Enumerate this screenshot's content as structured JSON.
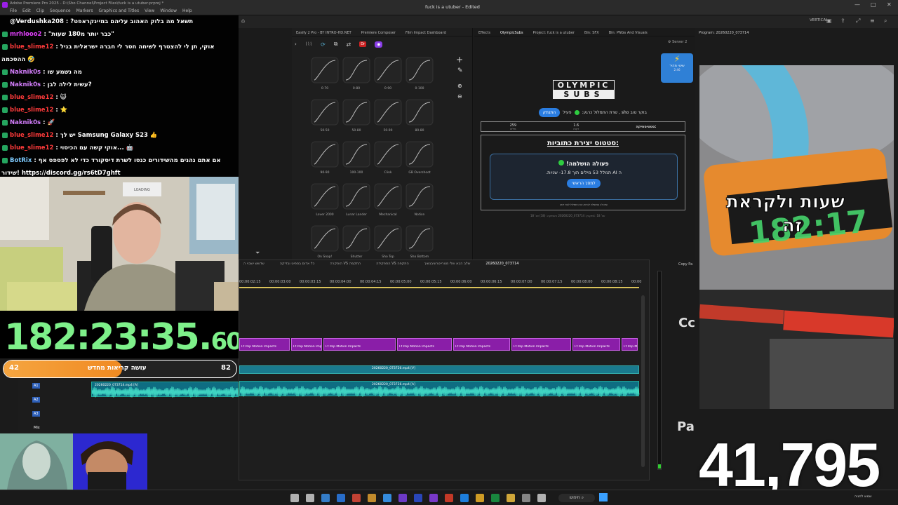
{
  "titlebar": {
    "path": "Adobe Premiere Pro 2025 - D:\\Sho Channel\\Project Files\\fuck is a utuber.prproj *",
    "menu": [
      "File",
      "Edit",
      "Clip",
      "Sequence",
      "Markers",
      "Graphics and Titles",
      "View",
      "Window",
      "Help"
    ],
    "center_title": "fuck is a utuber - Edited"
  },
  "topbar": {
    "label": "VERTICAL"
  },
  "chat": {
    "header": "@Verdushka208 : ?תשאל מה בלוק האהוב עליהם במיינקראפט",
    "lines": [
      {
        "user": "mrhlooo2",
        "text": "\"כבר יותר מ180 שעות\"",
        "color": "#e040fb"
      },
      {
        "user": "blue_slime12",
        "text": "אוקי, תן לי להצטרף לשיחה חסר לי חברה ישראלית בגיל",
        "color": "#ff3b3b"
      },
      {
        "user": "",
        "text": "ההסכמה 🤣",
        "color": "#fff"
      },
      {
        "user": "Naknik0s",
        "text": "מה נשמע שו",
        "color": "#d67fff"
      },
      {
        "user": "Naknik0s",
        "text": "עשית לילה לבן?",
        "color": "#d67fff"
      },
      {
        "user": "blue_slime12",
        "text": "😺",
        "color": "#ff3b3b"
      },
      {
        "user": "blue_slime12",
        "text": "⭐",
        "color": "#ff3b3b"
      },
      {
        "user": "Naknik0s",
        "text": "🚀",
        "color": "#d67fff"
      },
      {
        "user": "blue_slime12",
        "text": "יש לך Samsung Galaxy S23 👍",
        "color": "#ff3b3b"
      },
      {
        "user": "blue_slime12",
        "text": "אוקי קשה עם הכיסוי... 🤖",
        "color": "#ff3b3b"
      },
      {
        "user": "BotRix",
        "text": "אם אתם נהנים מהשידורים כנסו לשרת דיסקורד כדי לא לפספס אף",
        "color": "#7ecbff"
      },
      {
        "user": "",
        "text": "שידור! https://discord.gg/rs6tD7ghft",
        "color": "#fff"
      }
    ]
  },
  "webcam": {
    "poster_label": "LOADING"
  },
  "timer": {
    "main": "182:23:35.",
    "fraction": "60"
  },
  "progress": {
    "left": "42",
    "right": "82",
    "label": "עושה קריאות מחדש",
    "fill_fraction": 0.51
  },
  "effects": {
    "tabs": [
      "Easify 2 Pro - BY INTRO-HD.NET",
      "Premiere Composer",
      "Film Impact Dashboard"
    ],
    "curves": [
      "0-70",
      "0-80",
      "0-90",
      "0-100",
      "50-50",
      "50-80",
      "50-90",
      "80-80",
      "90-90",
      "100-100",
      "Clink",
      "GB Overshoot",
      "Lover 2000",
      "Lunar Lander",
      "Mechanical",
      "Notice",
      "On Snap!",
      "Shutter",
      "Sho Top",
      "Sho Bottom"
    ]
  },
  "olympic": {
    "tabs": [
      "Effects",
      "OlympicSubs",
      "Project: fuck is a utuber",
      "Bin: SFX",
      "Bin: PNGs And Visuals"
    ],
    "server": "Server 2",
    "logo_top": "OLYMPIC",
    "logo_bottom": "SUBS",
    "status_text": "בוקר טוב sho , שרת התמלול כרגע:",
    "status_state": "פעיל",
    "login_button": "התנתק",
    "stats": [
      {
        "value": "259",
        "label": "מילים"
      },
      {
        "value": "1.6",
        "label": "דקות"
      },
      {
        "value": "",
        "label": "סטטיסטיקה:"
      }
    ],
    "card_title": "סטטוס יצירת כתוביות:",
    "card_status": "פעולה הושלמה!",
    "card_detail": "ה AI תמלל 53 מילים תוך 17.8- שניות.",
    "card_button": "למסך הראשי",
    "card_footer": "שים לב שמומלץ לבדוק את התמלול לפני יצוא",
    "footer": "מקבץ: 073714_20260220 השמיעה: (18) שנ' 18s :שנ' 18"
  },
  "chip": {
    "text": "שינוי מהיר",
    "sub": "2:46"
  },
  "program": {
    "title": "Program: 20260220_073714",
    "caption_top": "שעות ולקראת",
    "caption_bottom": "זה",
    "clock": "182:17"
  },
  "timeline": {
    "tabs": [
      "שדשש ישבוי ה",
      "כל אדום בספיט ובדיקה",
      "הוסקרה VS התקפה",
      "התפקידה VS התקפה",
      "שלב הבא שלי מטרייטרוניבגשיך",
      "20260220_073714"
    ],
    "timecodes": [
      "00:00:02:15",
      "00:00:03:00",
      "00:00:03:15",
      "00:00:04:00",
      "00:00:04:15",
      "00:00:05:00",
      "00:00:05:15",
      "00:00:06:00",
      "00:00:06:15",
      "00:00:07:00",
      "00:00:07:15",
      "00:00:08:00",
      "00:00:08:15",
      "00:00"
    ],
    "clip_label": "Ft Pop Motion Impacts",
    "video_clip": "20260220_073726.mp4 [V]",
    "audio_clip_1": "20260220_073714.mp4 [A]",
    "audio_clip_2": "20260220_073726.mp4 [A]",
    "tracks": [
      "A1",
      "A2",
      "A3",
      "Mix"
    ]
  },
  "mixer": {
    "label": "Copy Pa",
    "big_letters_top": "Cc",
    "big_letters_bottom": "Pa"
  },
  "subcount": "41,795",
  "taskbar": {
    "search": "חיפוש",
    "clock": "שמש לחניה"
  },
  "colors": {
    "accent_purple": "#8a1ea8",
    "accent_teal": "#1a7a8e",
    "timer_green": "#7ef08a",
    "progress_orange": "#f29a2e"
  }
}
